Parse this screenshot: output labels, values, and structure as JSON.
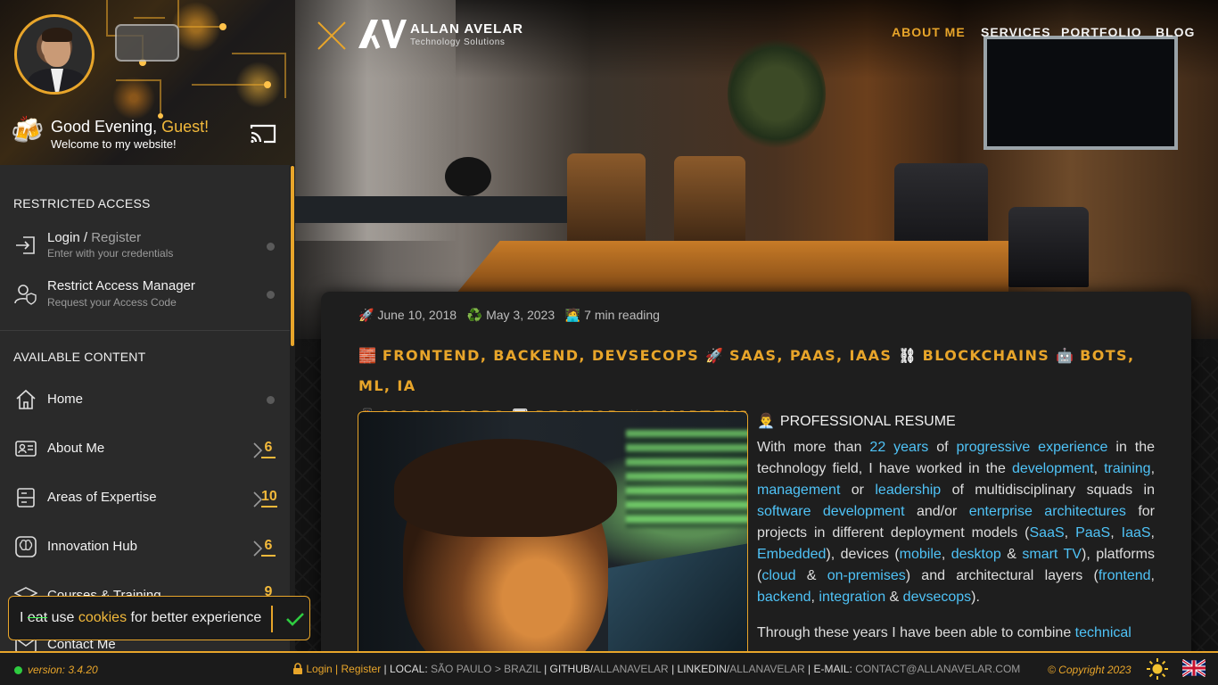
{
  "sidebar": {
    "greeting": "Good Evening, ",
    "guest": "Guest!",
    "welcome": "Welcome to my website!",
    "restricted_title": "RESTRICTED ACCESS",
    "login": {
      "label_a": "Login / ",
      "label_b": "Register",
      "sub": "Enter with your credentials"
    },
    "restrict_manager": {
      "label": "Restrict Access Manager",
      "sub": "Request your Access Code"
    },
    "available_title": "AVAILABLE CONTENT",
    "items": [
      {
        "label": "Home",
        "count": ""
      },
      {
        "label": "About Me",
        "count": "6"
      },
      {
        "label": "Areas of Expertise",
        "count": "10"
      },
      {
        "label": "Innovation Hub",
        "count": "6"
      },
      {
        "label": "Courses & Training",
        "count": "9"
      },
      {
        "label": "Contact Me",
        "count": ""
      }
    ]
  },
  "cookie": {
    "i": "I ",
    "eat": "eat",
    "use": " use ",
    "cookies": "cookies",
    "rest": " for better experience"
  },
  "header": {
    "brand_name": "ALLAN AVELAR",
    "brand_tag": "Technology Solutions",
    "nav": [
      "ABOUT ME",
      "SERVICES",
      "PORTFOLIO",
      "BLOG"
    ],
    "active_nav": "ABOUT ME"
  },
  "article": {
    "published": "June 10, 2018",
    "updated": "May 3, 2023",
    "reading": "7 min reading",
    "categories": [
      {
        "emoji": "🧱",
        "text": "FRONTEND, BACKEND, DEVSECOPS"
      },
      {
        "emoji": "🚀",
        "text": "SAAS, PAAS, IAAS"
      },
      {
        "emoji": "⛓",
        "text": "BLOCKCHAINS"
      },
      {
        "emoji": "🤖",
        "text": "BOTS, ML, IA"
      },
      {
        "emoji": "📱",
        "text": "MOBILE APPS"
      },
      {
        "emoji": "🖥",
        "text": "DESKTOP"
      },
      {
        "emoji": "📺",
        "text": "SMART-TVS"
      }
    ],
    "resume_title": "PROFESSIONAL RESUME",
    "p1": [
      {
        "t": "With more than "
      },
      {
        "t": "22 years",
        "link": true
      },
      {
        "t": " of "
      },
      {
        "t": "progressive experience",
        "link": true
      },
      {
        "t": " in the technology field, I have worked in the "
      },
      {
        "t": "development",
        "link": true
      },
      {
        "t": ", "
      },
      {
        "t": "training",
        "link": true
      },
      {
        "t": ", "
      },
      {
        "t": "management",
        "link": true
      },
      {
        "t": " or "
      },
      {
        "t": "leadership",
        "link": true
      },
      {
        "t": " of multidisciplinary squads in "
      },
      {
        "t": "software development",
        "link": true
      },
      {
        "t": " and/or "
      },
      {
        "t": "enterprise architectures",
        "link": true
      },
      {
        "t": " for projects in different deployment models ("
      },
      {
        "t": "SaaS",
        "link": true
      },
      {
        "t": ", "
      },
      {
        "t": "PaaS",
        "link": true
      },
      {
        "t": ", "
      },
      {
        "t": "IaaS",
        "link": true
      },
      {
        "t": ", "
      },
      {
        "t": "Embedded",
        "link": true
      },
      {
        "t": "), devices ("
      },
      {
        "t": "mobile",
        "link": true
      },
      {
        "t": ", "
      },
      {
        "t": "desktop",
        "link": true
      },
      {
        "t": " & "
      },
      {
        "t": "smart TV",
        "link": true
      },
      {
        "t": "), platforms ("
      },
      {
        "t": "cloud",
        "link": true
      },
      {
        "t": " & "
      },
      {
        "t": "on-premises",
        "link": true
      },
      {
        "t": ") and architectural layers ("
      },
      {
        "t": "frontend",
        "link": true
      },
      {
        "t": ", "
      },
      {
        "t": "backend",
        "link": true
      },
      {
        "t": ", "
      },
      {
        "t": "integration",
        "link": true
      },
      {
        "t": " & "
      },
      {
        "t": "devsecops",
        "link": true
      },
      {
        "t": ")."
      }
    ],
    "p2": [
      {
        "t": "Through these years I have been able to combine "
      },
      {
        "t": "technical",
        "link": true
      }
    ]
  },
  "footer": {
    "version": "version: 3.4.20",
    "login": "Login",
    "pipe": " | ",
    "register": "Register",
    "local_label": "LOCAL: ",
    "local_value": "SÃO PAULO > BRAZIL",
    "github_label": "GITHUB/",
    "github_value": "ALLANAVELAR",
    "linkedin_label": "LINKEDIN/",
    "linkedin_value": "ALLANAVELAR",
    "email_label": "E-MAIL: ",
    "email_value": "CONTACT@ALLANAVELAR.COM",
    "copyright": "© Copyright 2023"
  },
  "colors": {
    "accent": "#e8a52a",
    "link": "#4fc3f7",
    "sidebar_bg": "#2a2a2a"
  },
  "icons": [
    "user-avatar",
    "beer-icon",
    "cast-icon",
    "login-icon",
    "user-shield-icon",
    "home-icon",
    "id-card-icon",
    "server-icon",
    "brain-icon",
    "graduation-icon",
    "mail-icon",
    "check-icon",
    "sun-icon",
    "uk-flag-icon"
  ]
}
